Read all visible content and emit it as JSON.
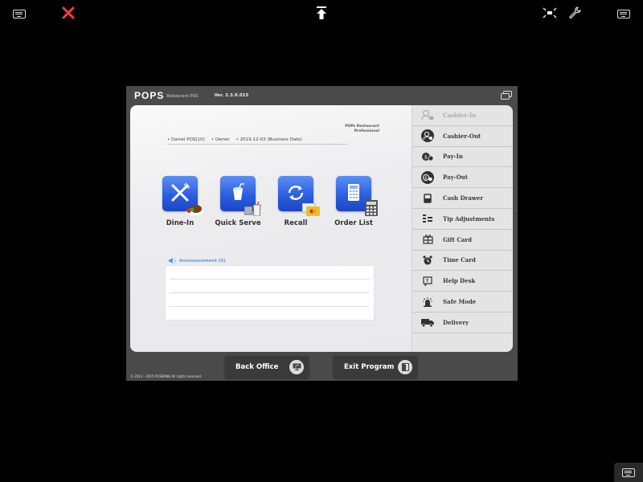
{
  "topbar": {
    "left_keyboard_icon": "keyboard-icon",
    "close_icon": "close-icon",
    "upload_icon": "arrow-up-to-bar-icon",
    "shrink_icon": "shrink-icon",
    "wrench_icon": "wrench-icon",
    "right_keyboard_icon": "keyboard-icon",
    "colors": {
      "close": "#ff3b3b",
      "icon": "#dddddd"
    }
  },
  "pos": {
    "logo": "POPS",
    "logo_sub": "Restaurant POS",
    "version": "Ver. 2.3.0.015",
    "brand_line1": "POPs Restaurant",
    "brand_line2": "Professional",
    "user": "• Daniel POS[10]",
    "role": "• Owner",
    "business_date": "• 2019-12-03 (Business Date)",
    "tiles": [
      {
        "label": "Dine-In",
        "icon": "dine-in-icon"
      },
      {
        "label": "Quick Serve",
        "icon": "quick-serve-icon"
      },
      {
        "label": "Recall",
        "icon": "recall-icon"
      },
      {
        "label": "Order List",
        "icon": "order-list-icon"
      }
    ],
    "announcement": {
      "label": "Announcement (0)",
      "lines": [
        "",
        "",
        ""
      ]
    },
    "menu": [
      {
        "label": "Cashier-In",
        "icon": "cashier-in-icon",
        "disabled": true
      },
      {
        "label": "Cashier-Out",
        "icon": "cashier-out-icon",
        "disabled": false
      },
      {
        "label": "Pay-In",
        "icon": "pay-in-icon",
        "disabled": false
      },
      {
        "label": "Pay-Out",
        "icon": "pay-out-icon",
        "disabled": false
      },
      {
        "label": "Cash Drawer",
        "icon": "cash-drawer-icon",
        "disabled": false
      },
      {
        "label": "Tip Adjustments",
        "icon": "tip-adjustments-icon",
        "disabled": false
      },
      {
        "label": "Gift Card",
        "icon": "gift-card-icon",
        "disabled": false
      },
      {
        "label": "Time Card",
        "icon": "time-card-icon",
        "disabled": false
      },
      {
        "label": "Help Desk",
        "icon": "help-desk-icon",
        "disabled": false
      },
      {
        "label": "Safe Mode",
        "icon": "safe-mode-icon",
        "disabled": false
      },
      {
        "label": "Delivery",
        "icon": "delivery-icon",
        "disabled": false
      }
    ],
    "back_office": "Back Office",
    "exit_program": "Exit Program",
    "copyright": "©  2013 - 2015 POSBANK All rights reserved.",
    "colors": {
      "tile_blue": "#2a5fe0",
      "announcement": "#5d9ad6",
      "frame": "#4a4a4a"
    }
  }
}
